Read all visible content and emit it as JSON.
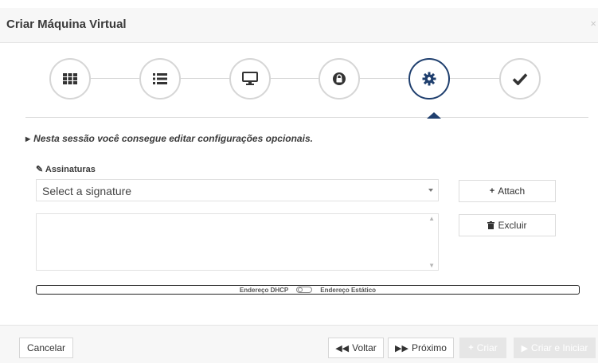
{
  "modal": {
    "title": "Criar Máquina Virtual",
    "close": "×"
  },
  "wizard": {
    "steps": [
      {
        "icon": "grid-icon"
      },
      {
        "icon": "list-icon"
      },
      {
        "icon": "monitor-icon"
      },
      {
        "icon": "lock-icon"
      },
      {
        "icon": "gear-icon",
        "active": true
      },
      {
        "icon": "check-icon"
      }
    ],
    "active_color": "#1f3f6e"
  },
  "info_text": "Nesta sessão você consegue editar configurações opcionais.",
  "signatures": {
    "label": "Assinaturas",
    "select_value": "Select a signature",
    "attach_label": "Attach",
    "delete_label": "Excluir"
  },
  "network_toggle": {
    "left_label": "Endereço DHCP",
    "right_label": "Endereço Estático"
  },
  "footer": {
    "cancel": "Cancelar",
    "back": "Voltar",
    "next": "Próximo",
    "create": "Criar",
    "create_start": "Criar e Iniciar"
  }
}
